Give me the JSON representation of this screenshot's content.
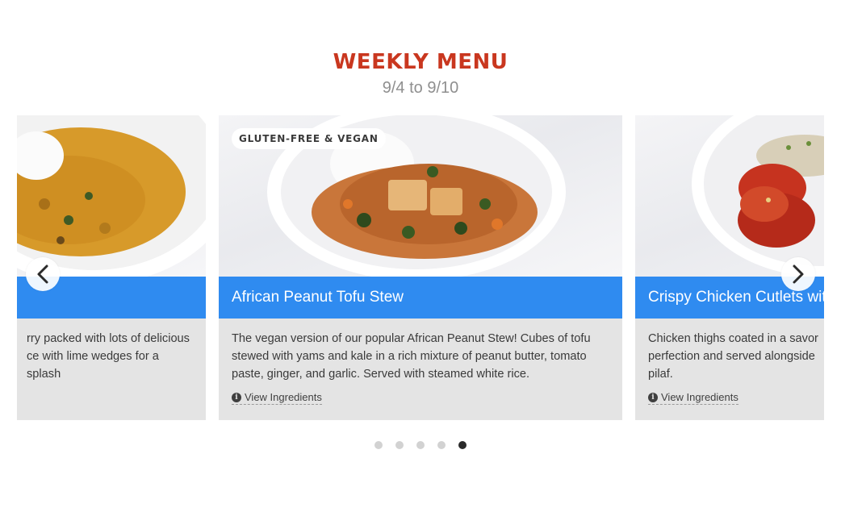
{
  "header": {
    "title": "WEEKLY MENU",
    "dates": "9/4 to 9/10"
  },
  "cards": {
    "left": {
      "title": "",
      "desc_line1": "rry packed with lots of delicious",
      "desc_line2": "ce with lime wedges for a splash"
    },
    "center": {
      "badge": "GLUTEN-FREE & VEGAN",
      "title": "African Peanut Tofu Stew",
      "description": "The vegan version of our popular African Peanut Stew! Cubes of tofu stewed with yams and kale in a rich mixture of peanut butter, tomato paste, ginger, and garlic. Served with steamed white rice.",
      "link": "View Ingredients"
    },
    "right": {
      "title": "Crispy Chicken Cutlets with",
      "desc_line1": "Chicken thighs coated in a savor",
      "desc_line2": "perfection and served alongside",
      "desc_line3": "pilaf.",
      "link": "View Ingredients"
    }
  },
  "navigation": {
    "prev_icon": "chevron-left-icon",
    "next_icon": "chevron-right-icon"
  },
  "pagination": {
    "total": 5,
    "active": 5
  },
  "colors": {
    "title": "#c9371f",
    "accent_bar": "#2f8bf0",
    "card_bg": "#e4e4e4",
    "dot_active": "#2a2a2a",
    "dot_inactive": "#d2d2d2"
  }
}
